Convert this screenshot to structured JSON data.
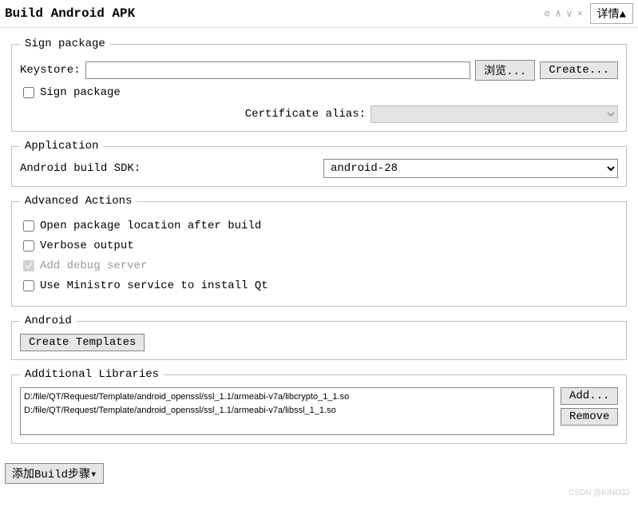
{
  "header": {
    "title": "Build Android APK",
    "details_label": "详情▲"
  },
  "sign": {
    "legend": "Sign package",
    "keystore_label": "Keystore:",
    "keystore_value": "",
    "browse_label": "浏览...",
    "create_label": "Create...",
    "sign_checkbox_label": "Sign package",
    "cert_alias_label": "Certificate alias:"
  },
  "application": {
    "legend": "Application",
    "sdk_label": "Android build SDK:",
    "sdk_value": "android-28"
  },
  "advanced": {
    "legend": "Advanced Actions",
    "open_location": "Open package location after build",
    "verbose": "Verbose output",
    "add_debug": "Add debug server",
    "ministro": "Use Ministro service to install Qt"
  },
  "android": {
    "legend": "Android",
    "create_templates": "Create Templates"
  },
  "libs": {
    "legend": "Additional Libraries",
    "items": [
      "D:/file/QT/Request/Template/android_openssl/ssl_1.1/armeabi-v7a/libcrypto_1_1.so",
      "D:/file/QT/Request/Template/android_openssl/ssl_1.1/armeabi-v7a/libssl_1_1.so"
    ],
    "add_label": "Add...",
    "remove_label": "Remove"
  },
  "bottom": {
    "add_step": "添加Build步骤▾"
  },
  "watermark": "CSDN @KINO32"
}
